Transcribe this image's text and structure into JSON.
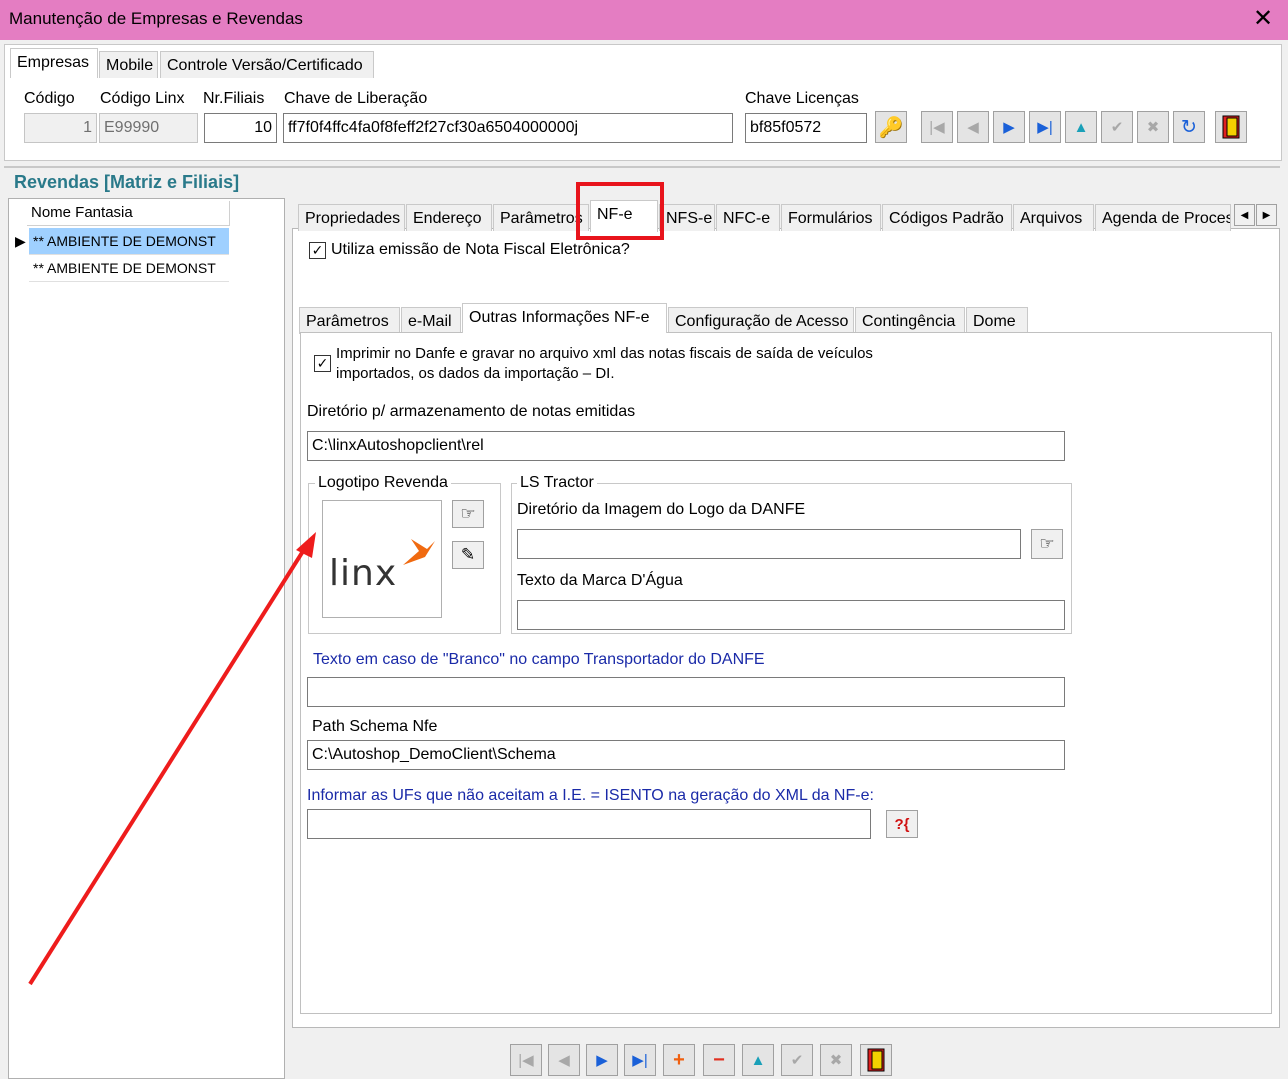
{
  "window": {
    "title": "Manutenção de Empresas e Revendas"
  },
  "top_tabs": [
    "Empresas",
    "Mobile",
    "Controle Versão/Certificado"
  ],
  "empresa": {
    "codigo_label": "Código",
    "codigo_value": "1",
    "codigo_linx_label": "Código Linx",
    "codigo_linx_value": "E99990",
    "nr_filiais_label": "Nr.Filiais",
    "nr_filiais_value": "10",
    "chave_liberacao_label": "Chave de Liberação",
    "chave_liberacao_value": "ff7f0f4ffc4fa0f8feff2f27cf30a6504000000j",
    "chave_licencas_label": "Chave Licenças",
    "chave_licencas_value": "bf85f0572"
  },
  "revendas": {
    "title": "Revendas [Matriz e Filiais]",
    "column": "Nome Fantasia",
    "rows": [
      "** AMBIENTE DE DEMONST",
      "** AMBIENTE DE DEMONST"
    ]
  },
  "main_tabs": [
    "Propriedades",
    "Endereço",
    "Parâmetros",
    "NF-e",
    "NFS-e",
    "NFC-e",
    "Formulários",
    "Códigos Padrão",
    "Arquivos",
    "Agenda de Proces"
  ],
  "nfe": {
    "utiliza_label": "Utiliza emissão de Nota Fiscal Eletrônica?",
    "sub_tabs": [
      "Parâmetros",
      "e-Mail",
      "Outras Informações NF-e",
      "Configuração de Acesso",
      "Contingência",
      "Dome"
    ],
    "imprimir_label_1": "Imprimir no Danfe e gravar no arquivo xml das notas fiscais de saída de veículos",
    "imprimir_label_2": "importados, os dados da importação – DI.",
    "diretorio_label": "Diretório p/ armazenamento de notas emitidas",
    "diretorio_value": "C:\\linxAutoshopclient\\rel",
    "logotipo_title": "Logotipo Revenda",
    "logo_text": "linx",
    "ls_tractor_title": "LS Tractor",
    "dir_imagem_label": "Diretório da Imagem do Logo da DANFE",
    "dir_imagem_value": "",
    "marca_agua_label": "Texto da Marca D'Água",
    "marca_agua_value": "",
    "branco_label": "Texto em caso de \"Branco\" no campo Transportador do DANFE",
    "branco_value": "",
    "schema_label": "Path Schema Nfe",
    "schema_value": "C:\\Autoshop_DemoClient\\Schema",
    "ufs_label": "Informar as UFs que não aceitam a I.E. = ISENTO na geração do XML da NF-e:",
    "ufs_value": ""
  },
  "colors": {
    "titlebar": "#e47dc2",
    "highlight": "#e8141c",
    "arrow": "#ee1c1c",
    "selected_row": "#9fd0ff"
  }
}
